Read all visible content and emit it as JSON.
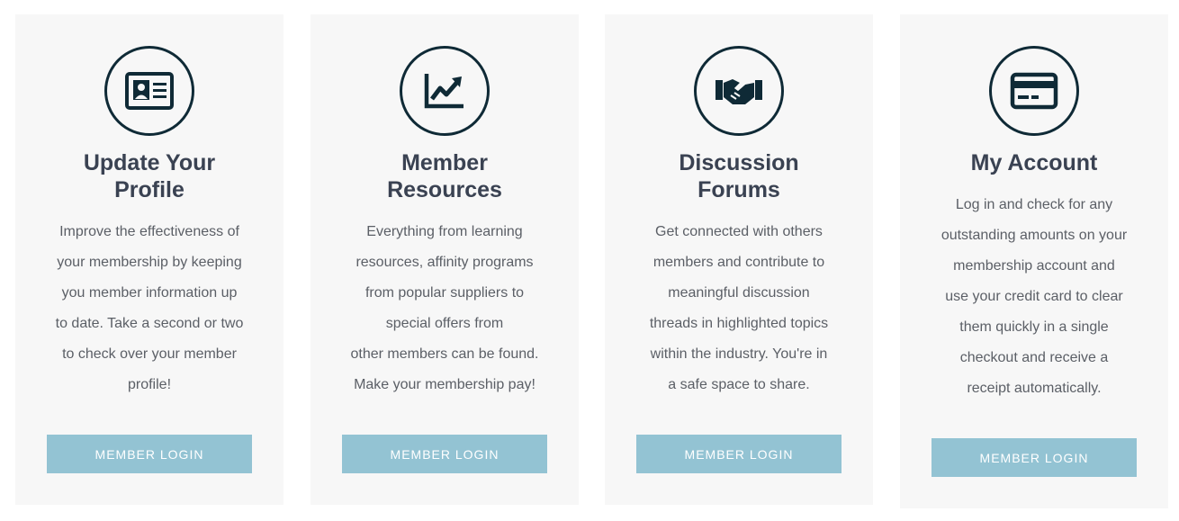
{
  "colors": {
    "card_background": "#f7f7f7",
    "icon_stroke": "#0f2a36",
    "title_text": "#3a4252",
    "body_text": "#5b5f66",
    "button_background": "#93c3d3",
    "button_text": "#ffffff"
  },
  "cards": [
    {
      "icon": "id-card-icon",
      "title": "Update Your\nProfile",
      "description": "Improve the effectiveness of\nyour membership by keeping\nyou member information up\nto date. Take a second or two\nto check over your member\nprofile!",
      "button_label": "MEMBER LOGIN"
    },
    {
      "icon": "chart-trend-icon",
      "title": "Member\nResources",
      "description": "Everything from learning\nresources, affinity programs\nfrom popular suppliers to\nspecial offers from\nother members can be found.\nMake your membership pay!",
      "button_label": "MEMBER LOGIN"
    },
    {
      "icon": "handshake-icon",
      "title": "Discussion\nForums",
      "description": "Get connected with others\nmembers and contribute to\nmeaningful discussion\nthreads in highlighted topics\nwithin the industry. You're in\na safe space to share.",
      "button_label": "MEMBER LOGIN"
    },
    {
      "icon": "credit-card-icon",
      "title": "My Account",
      "description": "Log in and check for any\noutstanding amounts on your\nmembership account and\nuse your credit card to clear\nthem quickly in a single\ncheckout and receive a\nreceipt automatically.",
      "button_label": "MEMBER LOGIN"
    }
  ]
}
